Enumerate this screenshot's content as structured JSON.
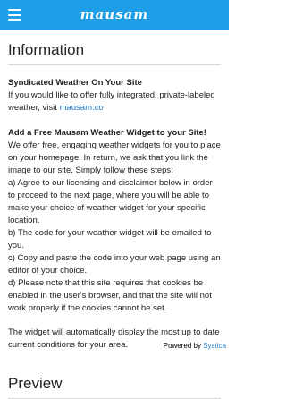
{
  "header": {
    "logo_text": "mausam",
    "menu_icon": "hamburger-menu-icon",
    "bg_color": "#1f9ee8"
  },
  "information": {
    "title": "Information",
    "syndicated_heading": "Syndicated Weather On Your Site",
    "syndicated_text": "If you would like to offer fully integrated, private-labeled weather, visit ",
    "syndicated_link": "mausam.co",
    "widget_heading": "Add a Free Mausam Weather Widget to your Site!",
    "widget_intro": "We offer free, engaging weather widgets for you to place on your homepage. In return, we ask that you link the image to our site. Simply follow these steps:",
    "steps": [
      "a) Agree to our licensing and disclaimer below in order to proceed to the next page, where you will be able to make your choice of weather widget for your specific location.",
      "b) The code for your weather widget will be emailed to you.",
      "c) Copy and paste the code into your web page using an editor of your choice.",
      "d) Please note that this site requires that cookies be enabled in the user's browser, and that the site will not work properly if the cookies cannot be set."
    ],
    "closing": "The widget will automatically display the most up to date current conditions for your area."
  },
  "preview": {
    "title": "Preview"
  },
  "footer": {
    "powered_by": "Powered by ",
    "brand": "Systica"
  },
  "colors": {
    "accent": "#1f9ee8",
    "link": "#1f7bc9"
  }
}
